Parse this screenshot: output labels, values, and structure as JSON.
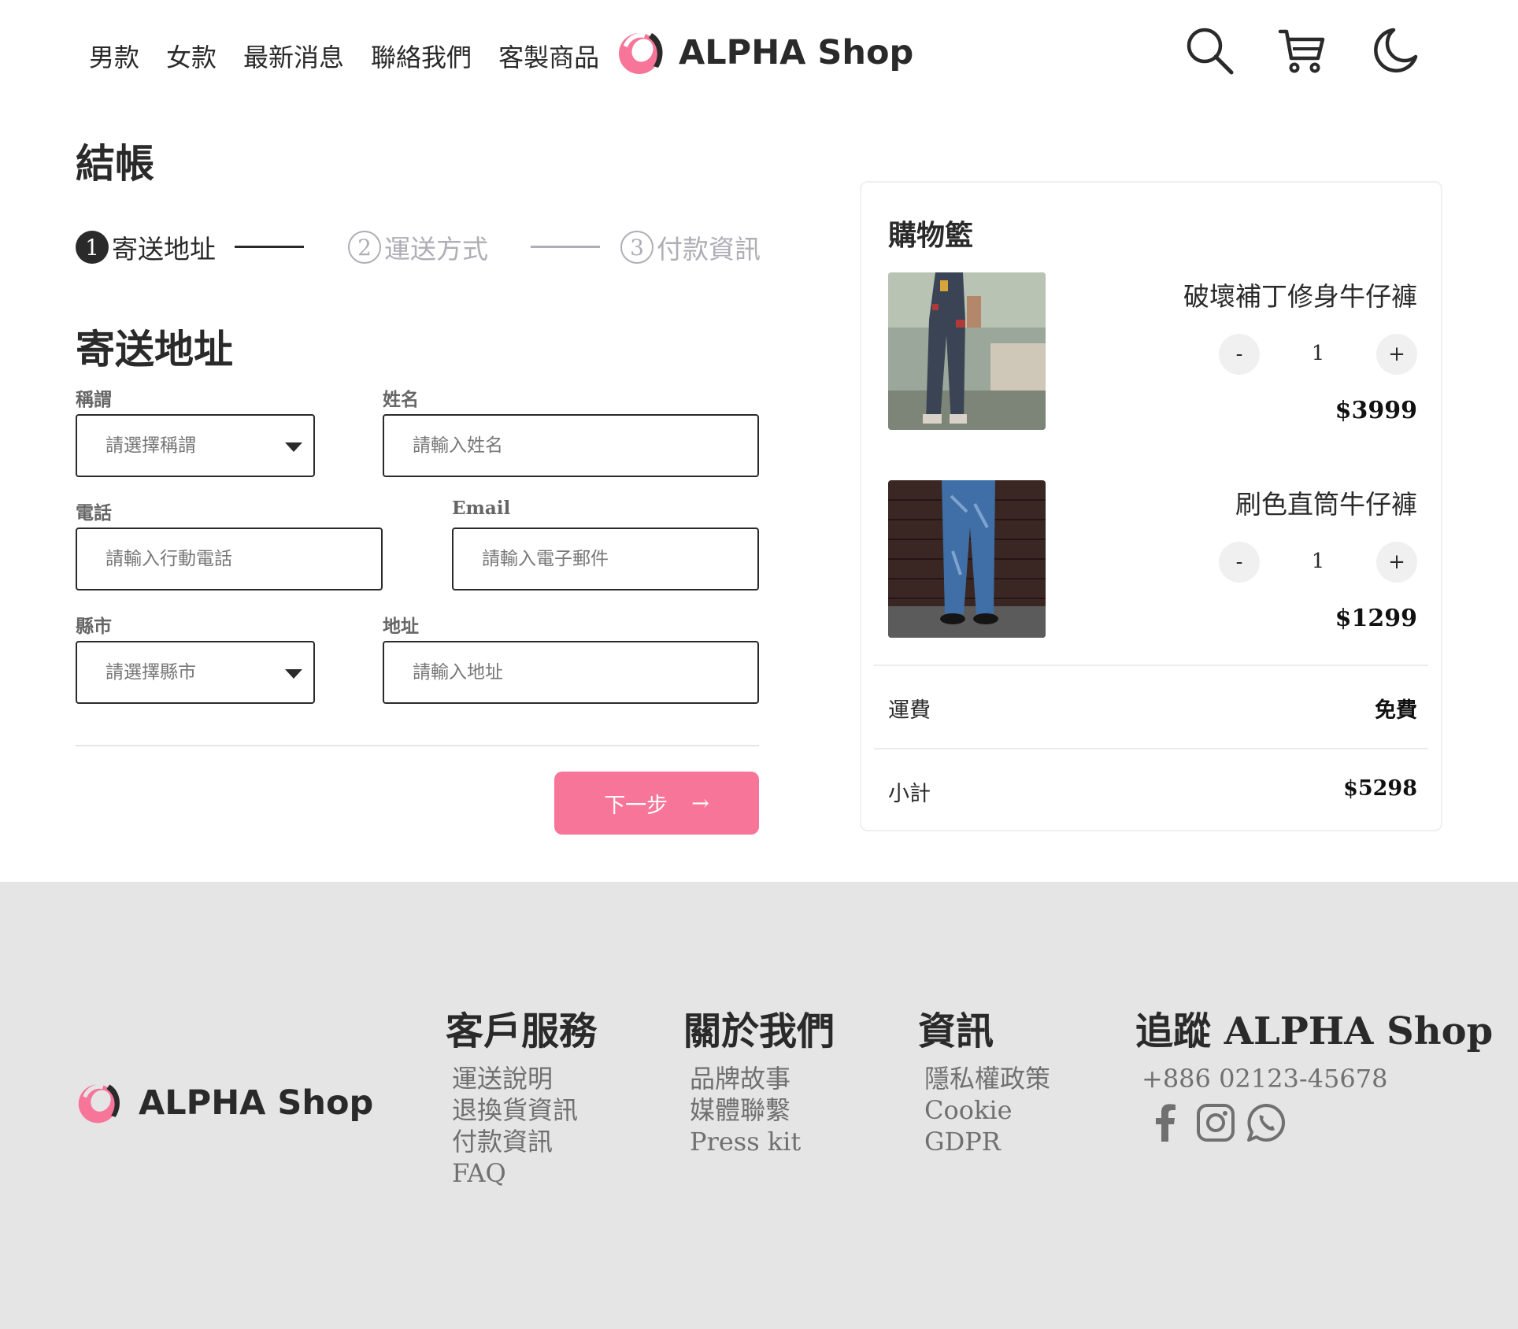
{
  "header": {
    "nav": [
      "男款",
      "女款",
      "最新消息",
      "聯絡我們",
      "客製商品"
    ],
    "brand": "ALPHA Shop",
    "icons": [
      "search-icon",
      "cart-icon",
      "moon-icon"
    ],
    "brand_accent": "#f67599"
  },
  "checkout": {
    "title": "結帳",
    "steps": [
      {
        "number": "1",
        "label": "寄送地址",
        "state": "active"
      },
      {
        "number": "2",
        "label": "運送方式",
        "state": "inactive"
      },
      {
        "number": "3",
        "label": "付款資訊",
        "state": "inactive"
      }
    ],
    "section_title": "寄送地址",
    "form": {
      "salutation": {
        "label": "稱謂",
        "placeholder": "請選擇稱謂"
      },
      "name": {
        "label": "姓名",
        "placeholder": "請輸入姓名"
      },
      "phone": {
        "label": "電話",
        "placeholder": "請輸入行動電話"
      },
      "email": {
        "label": "Email",
        "placeholder": "請輸入電子郵件"
      },
      "city": {
        "label": "縣市",
        "placeholder": "請選擇縣市"
      },
      "address": {
        "label": "地址",
        "placeholder": "請輸入地址"
      }
    },
    "next_button": {
      "label": "下一步",
      "arrow": "→"
    }
  },
  "cart": {
    "title": "購物籃",
    "items": [
      {
        "name": "破壞補丁修身牛仔褲",
        "quantity": "1",
        "price": "$3999",
        "minus": "-",
        "plus": "+"
      },
      {
        "name": "刷色直筒牛仔褲",
        "quantity": "1",
        "price": "$1299",
        "minus": "-",
        "plus": "+"
      }
    ],
    "shipping": {
      "label": "運費",
      "value": "免費"
    },
    "subtotal": {
      "label": "小計",
      "value": "$5298"
    }
  },
  "footer": {
    "brand": "ALPHA Shop",
    "columns": [
      {
        "title": "客戶服務",
        "links": [
          "運送說明",
          "退換貨資訊",
          "付款資訊",
          "FAQ"
        ]
      },
      {
        "title": "關於我們",
        "links": [
          "品牌故事",
          "媒體聯繫",
          "Press kit"
        ]
      },
      {
        "title": "資訊",
        "links": [
          "隱私權政策",
          "Cookie",
          "GDPR"
        ]
      }
    ],
    "follow": {
      "title": "追蹤 ALPHA Shop",
      "phone": "+886 02123-45678",
      "icons": [
        "facebook-icon",
        "instagram-icon",
        "whatsapp-icon"
      ]
    }
  }
}
